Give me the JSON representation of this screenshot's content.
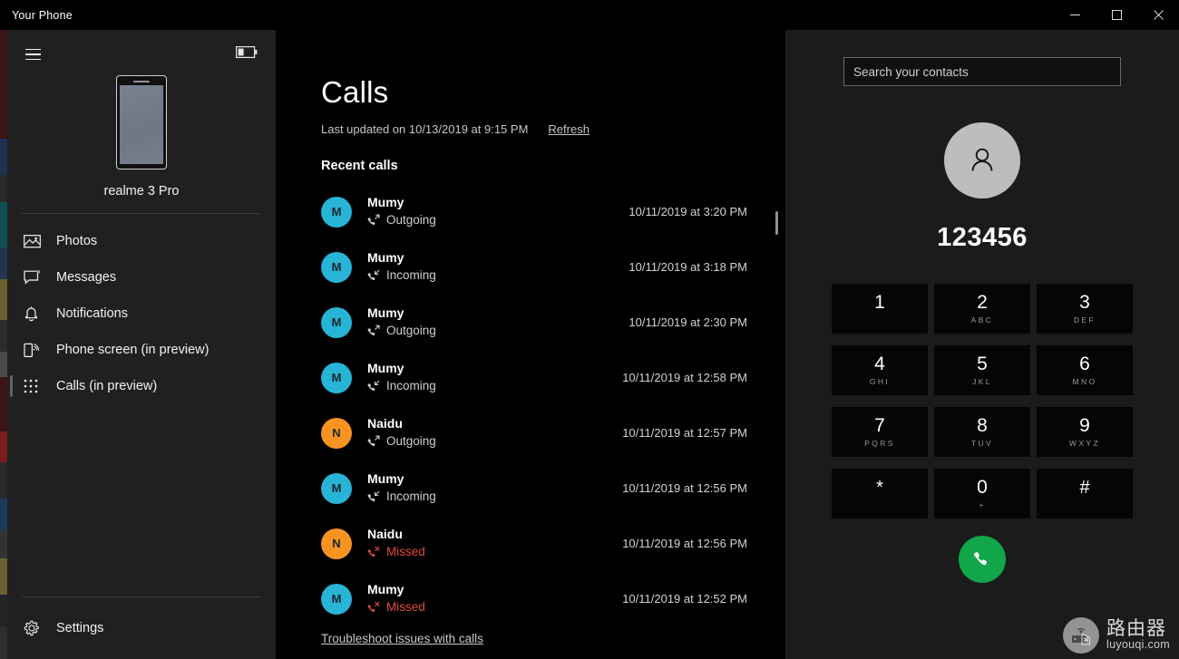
{
  "window": {
    "title": "Your Phone",
    "minimize_label": "Minimize",
    "maximize_label": "Maximize",
    "close_label": "Close"
  },
  "sidebar": {
    "menu_button": "Menu",
    "battery_icon": "battery-low-icon",
    "device_name": "realme 3 Pro",
    "items": [
      {
        "label": "Photos",
        "icon": "photos-icon",
        "selected": false
      },
      {
        "label": "Messages",
        "icon": "messages-icon",
        "selected": false
      },
      {
        "label": "Notifications",
        "icon": "bell-icon",
        "selected": false
      },
      {
        "label": "Phone screen (in preview)",
        "icon": "phone-screen-icon",
        "selected": false
      },
      {
        "label": "Calls (in preview)",
        "icon": "dialpad-icon",
        "selected": true
      }
    ],
    "settings": {
      "label": "Settings",
      "icon": "gear-icon"
    }
  },
  "main": {
    "title": "Calls",
    "last_updated": "Last updated on 10/13/2019 at 9:15 PM",
    "refresh_label": "Refresh",
    "section_title": "Recent calls",
    "troubleshoot_label": "Troubleshoot issues with calls",
    "calls": [
      {
        "name": "Mumy",
        "initial": "M",
        "type": "Outgoing",
        "time": "10/11/2019 at 3:20 PM",
        "avatar_color": "#27b4d6",
        "type_color": "#cfcfcf"
      },
      {
        "name": "Mumy",
        "initial": "M",
        "type": "Incoming",
        "time": "10/11/2019 at 3:18 PM",
        "avatar_color": "#27b4d6",
        "type_color": "#cfcfcf"
      },
      {
        "name": "Mumy",
        "initial": "M",
        "type": "Outgoing",
        "time": "10/11/2019 at 2:30 PM",
        "avatar_color": "#27b4d6",
        "type_color": "#cfcfcf"
      },
      {
        "name": "Mumy",
        "initial": "M",
        "type": "Incoming",
        "time": "10/11/2019 at 12:58 PM",
        "avatar_color": "#27b4d6",
        "type_color": "#cfcfcf"
      },
      {
        "name": "Naidu",
        "initial": "N",
        "type": "Outgoing",
        "time": "10/11/2019 at 12:57 PM",
        "avatar_color": "#f79421",
        "type_color": "#cfcfcf"
      },
      {
        "name": "Mumy",
        "initial": "M",
        "type": "Incoming",
        "time": "10/11/2019 at 12:56 PM",
        "avatar_color": "#27b4d6",
        "type_color": "#cfcfcf"
      },
      {
        "name": "Naidu",
        "initial": "N",
        "type": "Missed",
        "time": "10/11/2019 at 12:56 PM",
        "avatar_color": "#f79421",
        "type_color": "#e04b3c"
      },
      {
        "name": "Mumy",
        "initial": "M",
        "type": "Missed",
        "time": "10/11/2019 at 12:52 PM",
        "avatar_color": "#27b4d6",
        "type_color": "#e04b3c"
      }
    ]
  },
  "right": {
    "search_placeholder": "Search your contacts",
    "search_value": "",
    "avatar_icon": "person-icon",
    "dialed_number": "123456",
    "keys": [
      {
        "digit": "1",
        "letters": ""
      },
      {
        "digit": "2",
        "letters": "ABC"
      },
      {
        "digit": "3",
        "letters": "DEF"
      },
      {
        "digit": "4",
        "letters": "GHI"
      },
      {
        "digit": "5",
        "letters": "JKL"
      },
      {
        "digit": "6",
        "letters": "MNO"
      },
      {
        "digit": "7",
        "letters": "PQRS"
      },
      {
        "digit": "8",
        "letters": "TUV"
      },
      {
        "digit": "9",
        "letters": "WXYZ"
      },
      {
        "digit": "*",
        "letters": ""
      },
      {
        "digit": "0",
        "letters": "+"
      },
      {
        "digit": "#",
        "letters": ""
      }
    ],
    "call_button_label": "Call",
    "call_button_color": "#11a64a"
  },
  "watermark": {
    "cn": "路由器",
    "en": "luyouqi.com"
  },
  "colors": {
    "sidebar_bg": "#202020",
    "main_bg": "#000000",
    "right_bg": "#1b1b1b",
    "missed_red": "#e04b3c",
    "accent_cyan": "#27b4d6",
    "accent_orange": "#f79421"
  }
}
